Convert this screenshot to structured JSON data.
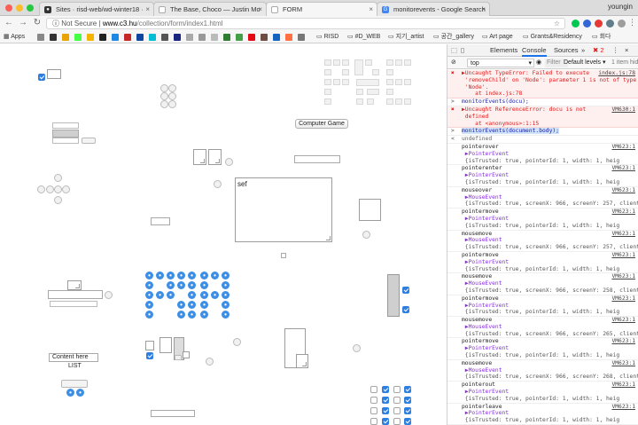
{
  "browser": {
    "tabs": [
      {
        "title": "Sites · risd-web/wd-winter18 ·",
        "icon": "github-icon"
      },
      {
        "title": "The Base, Choco — Justin Mo",
        "icon": "page-icon"
      },
      {
        "title": "FORM",
        "icon": "page-icon",
        "active": true
      },
      {
        "title": "monitorevents - Google Search",
        "icon": "google-icon"
      }
    ],
    "profile": "youngin",
    "security": "Not Secure",
    "url_host": "www.c3.hu",
    "url_path": "/collection/form/index1.html",
    "bookmarks": [
      "Apps",
      "RISD",
      "#D_WEB",
      "지기_artist",
      "공간_gallery",
      "Art page",
      "Grants&Residency",
      "회다"
    ]
  },
  "page": {
    "button_label": "Computer Game",
    "textarea_value": "sef",
    "content_input": "Content here",
    "list_label": "LIST"
  },
  "devtools": {
    "tabs": [
      "Elements",
      "Console",
      "Sources"
    ],
    "more": "»",
    "errors_count": "2",
    "context": "top",
    "filter_placeholder": "Filter",
    "levels": "Default levels ▾",
    "hidden_note": "1 item hid",
    "lines": [
      {
        "kind": "err",
        "prefix": "✖",
        "text": "▶Uncaught TypeError: Failed to execute\n 'removeChild' on 'Node': parameter 1 is not of type\n 'Node'.\n    at index.js:78",
        "link": "index.js:78"
      },
      {
        "kind": "in",
        "prefix": ">",
        "text": "monitorEvents(docu);"
      },
      {
        "kind": "err",
        "prefix": "✖",
        "text": "▶Uncaught ReferenceError: docu is not\n defined\n    at <anonymous>:1:15",
        "link": "VM630:1"
      },
      {
        "kind": "in",
        "prefix": ">",
        "text": "monitorEvents(document.body);"
      },
      {
        "kind": "out",
        "prefix": "<",
        "text": "undefined"
      },
      {
        "kind": "ev",
        "name": "pointerover",
        "type": "PointerEvent",
        "detail": "{isTrusted: true, pointerId: 1, width: 1, heig",
        "link": "VM623:1"
      },
      {
        "kind": "ev",
        "name": "pointerenter",
        "type": "PointerEvent",
        "detail": "{isTrusted: true, pointerId: 1, width: 1, heig",
        "link": "VM623:1"
      },
      {
        "kind": "ev",
        "name": "mouseover",
        "type": "MouseEvent",
        "detail": "{isTrusted: true, screenX: 966, screenY: 257, clientX",
        "link": "VM623:1"
      },
      {
        "kind": "ev",
        "name": "pointermove",
        "type": "PointerEvent",
        "detail": "{isTrusted: true, pointerId: 1, width: 1, heig",
        "link": "VM623:1"
      },
      {
        "kind": "ev",
        "name": "mousemove",
        "type": "MouseEvent",
        "detail": "{isTrusted: true, screenX: 966, screenY: 257, clientX",
        "link": "VM623:1"
      },
      {
        "kind": "ev",
        "name": "pointermove",
        "type": "PointerEvent",
        "detail": "{isTrusted: true, pointerId: 1, width: 1, heig",
        "link": "VM623:1"
      },
      {
        "kind": "ev",
        "name": "mousemove",
        "type": "MouseEvent",
        "detail": "{isTrusted: true, screenX: 966, screenY: 258, clientX",
        "link": "VM623:1"
      },
      {
        "kind": "ev",
        "name": "pointermove",
        "type": "PointerEvent",
        "detail": "{isTrusted: true, pointerId: 1, width: 1, heig",
        "link": "VM623:1"
      },
      {
        "kind": "ev",
        "name": "mousemove",
        "type": "MouseEvent",
        "detail": "{isTrusted: true, screenX: 966, screenY: 265, clientX",
        "link": "VM623:1"
      },
      {
        "kind": "ev",
        "name": "pointermove",
        "type": "PointerEvent",
        "detail": "{isTrusted: true, pointerId: 1, width: 1, heig",
        "link": "VM623:1"
      },
      {
        "kind": "ev",
        "name": "mousemove",
        "type": "MouseEvent",
        "detail": "{isTrusted: true, screenX: 966, screenY: 268, clientX",
        "link": "VM623:1"
      },
      {
        "kind": "ev",
        "name": "pointerout",
        "type": "PointerEvent",
        "detail": "{isTrusted: true, pointerId: 1, width: 1, heig",
        "link": "VM623:1"
      },
      {
        "kind": "ev",
        "name": "pointerleave",
        "type": "PointerEvent",
        "detail": "{isTrusted: true, pointerId: 1, width: 1, heig",
        "link": "VM623:1"
      }
    ]
  },
  "colors": {
    "accent_blue": "#3d8fe6",
    "error_red": "#e01b1b",
    "error_bg": "#fff0f0"
  }
}
